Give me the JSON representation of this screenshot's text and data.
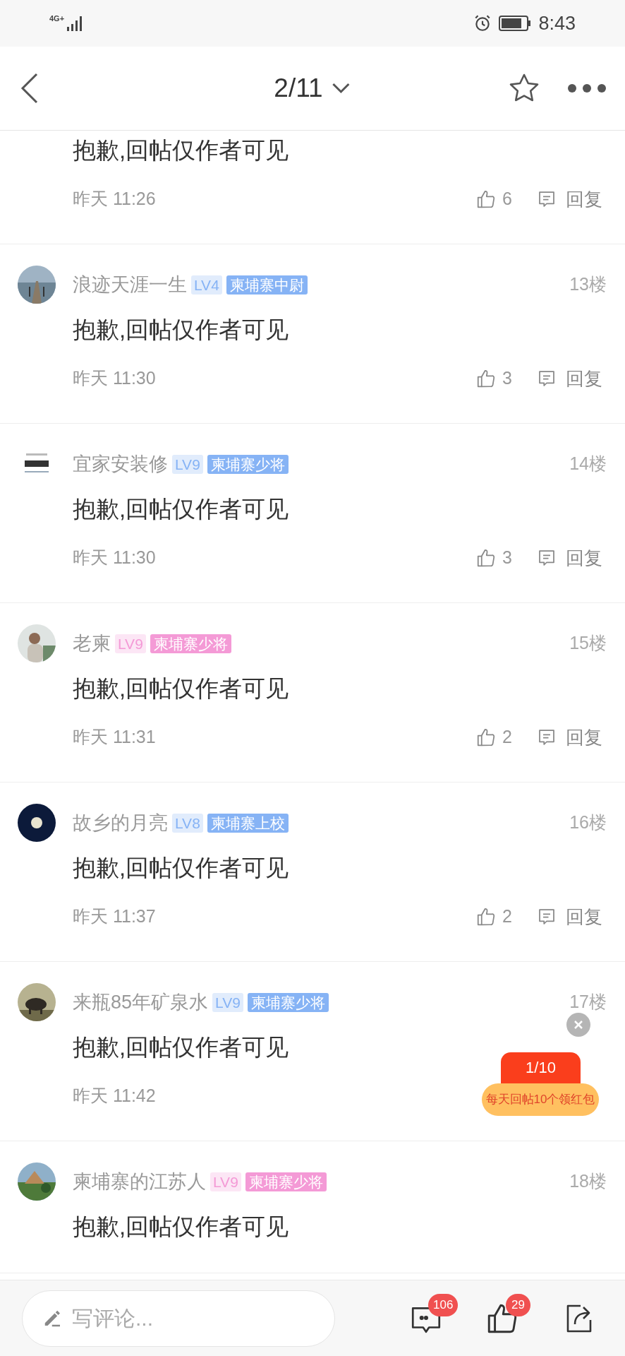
{
  "status_bar": {
    "network": "4G+",
    "time": "8:43"
  },
  "nav": {
    "page": "2/11"
  },
  "posts": [
    {
      "content": "抱歉,回帖仅作者可见",
      "time": "昨天 11:26",
      "likes": "6",
      "reply": "回复"
    },
    {
      "author": "浪迹天涯一生",
      "level": "LV4",
      "title": "柬埔寨中尉",
      "color": "#86b3f5",
      "floor": "13楼",
      "content": "抱歉,回帖仅作者可见",
      "time": "昨天 11:30",
      "likes": "3",
      "reply": "回复"
    },
    {
      "author": "宜家安装修",
      "level": "LV9",
      "title": "柬埔寨少将",
      "color": "#86b3f5",
      "floor": "14楼",
      "content": "抱歉,回帖仅作者可见",
      "time": "昨天 11:30",
      "likes": "3",
      "reply": "回复"
    },
    {
      "author": "老柬",
      "level": "LV9",
      "title": "柬埔寨少将",
      "color": "#f49ad6",
      "floor": "15楼",
      "content": "抱歉,回帖仅作者可见",
      "time": "昨天 11:31",
      "likes": "2",
      "reply": "回复"
    },
    {
      "author": "故乡的月亮",
      "level": "LV8",
      "title": "柬埔寨上校",
      "color": "#86b3f5",
      "floor": "16楼",
      "content": "抱歉,回帖仅作者可见",
      "time": "昨天 11:37",
      "likes": "2",
      "reply": "回复"
    },
    {
      "author": "来瓶85年矿泉水",
      "level": "LV9",
      "title": "柬埔寨少将",
      "color": "#86b3f5",
      "floor": "17楼",
      "content": "抱歉,回帖仅作者可见",
      "time": "昨天 11:42"
    },
    {
      "author": "柬埔寨的江苏人",
      "level": "LV9",
      "title": "柬埔寨少将",
      "color": "#f49ad6",
      "floor": "18楼",
      "content": "抱歉,回帖仅作者可见"
    }
  ],
  "red_packet": {
    "progress": "1/10",
    "message": "每天回帖10个领红包"
  },
  "bottom_bar": {
    "placeholder": "写评论...",
    "comments_badge": "106",
    "likes_badge": "29"
  }
}
